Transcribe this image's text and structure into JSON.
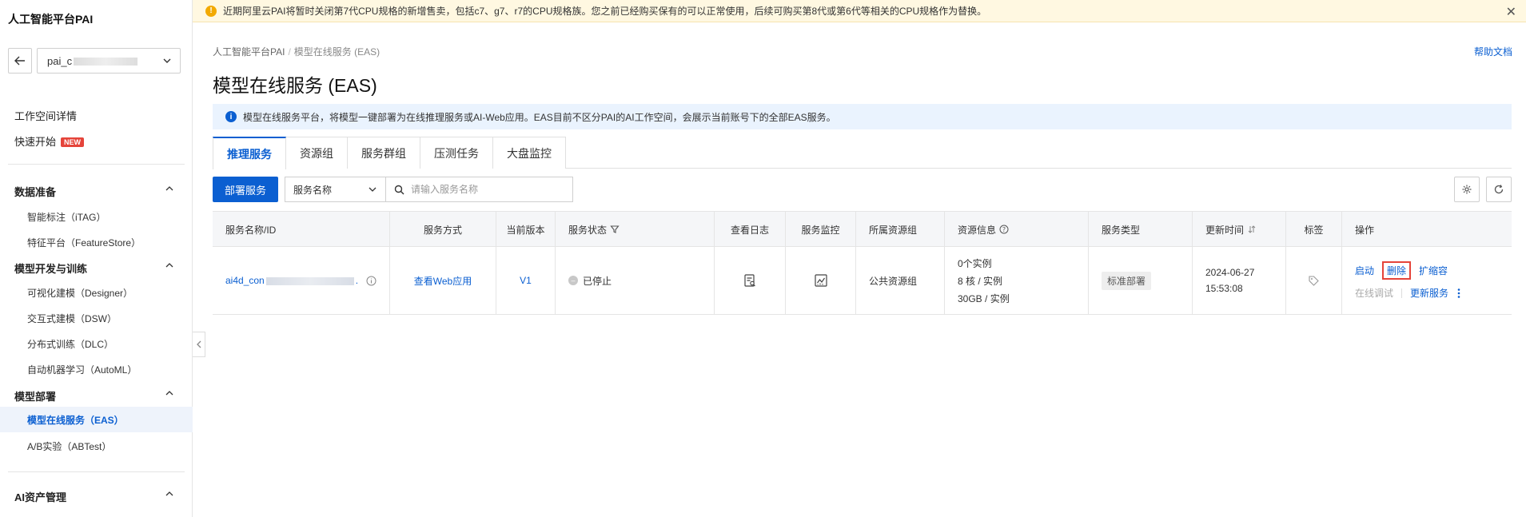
{
  "sidebar": {
    "app_title": "人工智能平台PAI",
    "workspace_prefix": "pai_c",
    "workspace_suffix": "",
    "link_workspace_details": "工作空间详情",
    "link_quick_start": "快速开始",
    "new_badge": "NEW",
    "groups": {
      "data_prep": {
        "label": "数据准备",
        "items": [
          "智能标注（iTAG）",
          "特征平台（FeatureStore）"
        ]
      },
      "dev_train": {
        "label": "模型开发与训练",
        "items": [
          "可视化建模（Designer）",
          "交互式建模（DSW）",
          "分布式训练（DLC）",
          "自动机器学习（AutoML）"
        ]
      },
      "deploy": {
        "label": "模型部署",
        "items": [
          "模型在线服务（EAS）",
          "A/B实验（ABTest）"
        ]
      },
      "ai_assets": {
        "label": "AI资产管理"
      }
    }
  },
  "banner": {
    "text": "近期阿里云PAI将暂时关闭第7代CPU规格的新增售卖，包括c7、g7、r7的CPU规格族。您之前已经购买保有的可以正常使用，后续可购买第8代或第6代等相关的CPU规格作为替换。"
  },
  "header": {
    "breadcrumb_root": "人工智能平台PAI",
    "breadcrumb_sep": "/",
    "breadcrumb_current": "模型在线服务 (EAS)",
    "help_link": "帮助文档",
    "title": "模型在线服务 (EAS)"
  },
  "info_bar": {
    "text": "模型在线服务平台，将模型一键部署为在线推理服务或AI-Web应用。EAS目前不区分PAI的AI工作空间，会展示当前账号下的全部EAS服务。"
  },
  "tabs": [
    "推理服务",
    "资源组",
    "服务群组",
    "压测任务",
    "大盘监控"
  ],
  "toolbar": {
    "deploy_label": "部署服务",
    "search_field": "服务名称",
    "search_placeholder": "请输入服务名称"
  },
  "table": {
    "columns": [
      "服务名称/ID",
      "服务方式",
      "当前版本",
      "服务状态",
      "查看日志",
      "服务监控",
      "所属资源组",
      "资源信息",
      "服务类型",
      "更新时间",
      "标签",
      "操作"
    ],
    "rows": [
      {
        "name_prefix": "ai4d_con",
        "name_suffix": ".",
        "service_mode": "查看Web应用",
        "version": "V1",
        "status": "已停止",
        "resource_group": "公共资源组",
        "res_instances": "0个实例",
        "res_cores": "8 核 / 实例",
        "res_memory": "30GB / 实例",
        "service_type": "标准部署",
        "updated_date": "2024-06-27",
        "updated_time": "15:53:08",
        "ops": {
          "start": "启动",
          "delete": "删除",
          "scale": "扩缩容",
          "online_debug": "在线调试",
          "update": "更新服务"
        }
      }
    ]
  },
  "colors": {
    "accent": "#0b5fd1",
    "danger": "#e5443a",
    "warning": "#f2a900"
  }
}
